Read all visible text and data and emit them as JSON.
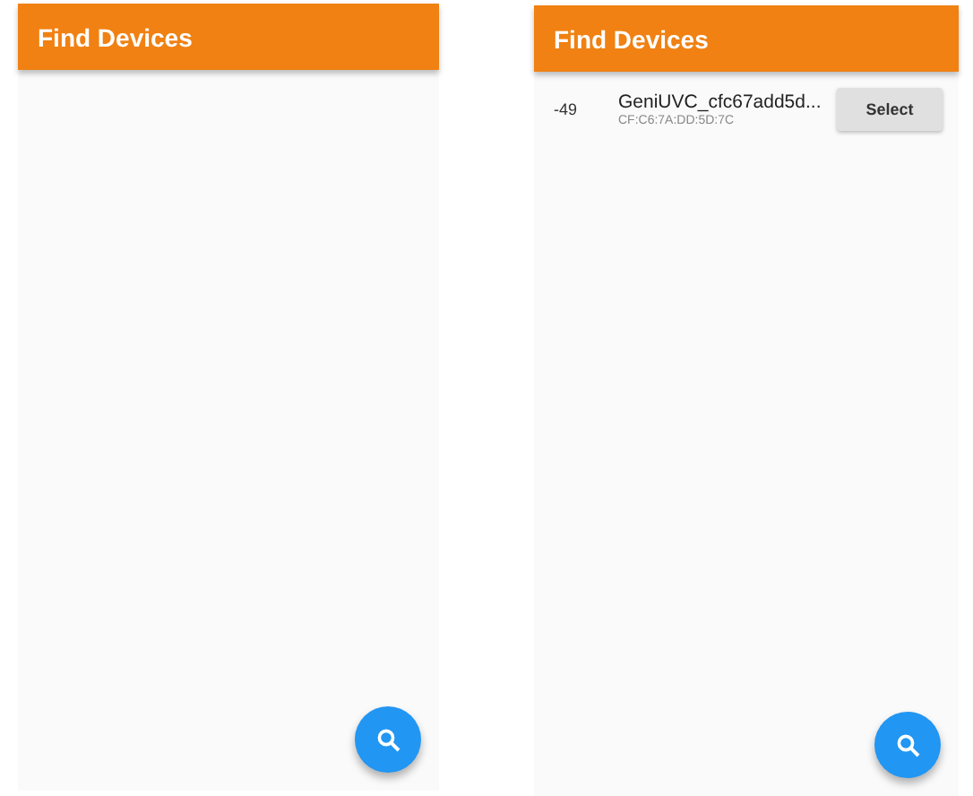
{
  "screens": [
    {
      "app_bar": {
        "title": "Find Devices"
      }
    },
    {
      "app_bar": {
        "title": "Find Devices"
      },
      "devices": [
        {
          "rssi": "-49",
          "name": "GeniUVC_cfc67add5d...",
          "address": "CF:C6:7A:DD:5D:7C",
          "button": "Select"
        }
      ]
    }
  ]
}
